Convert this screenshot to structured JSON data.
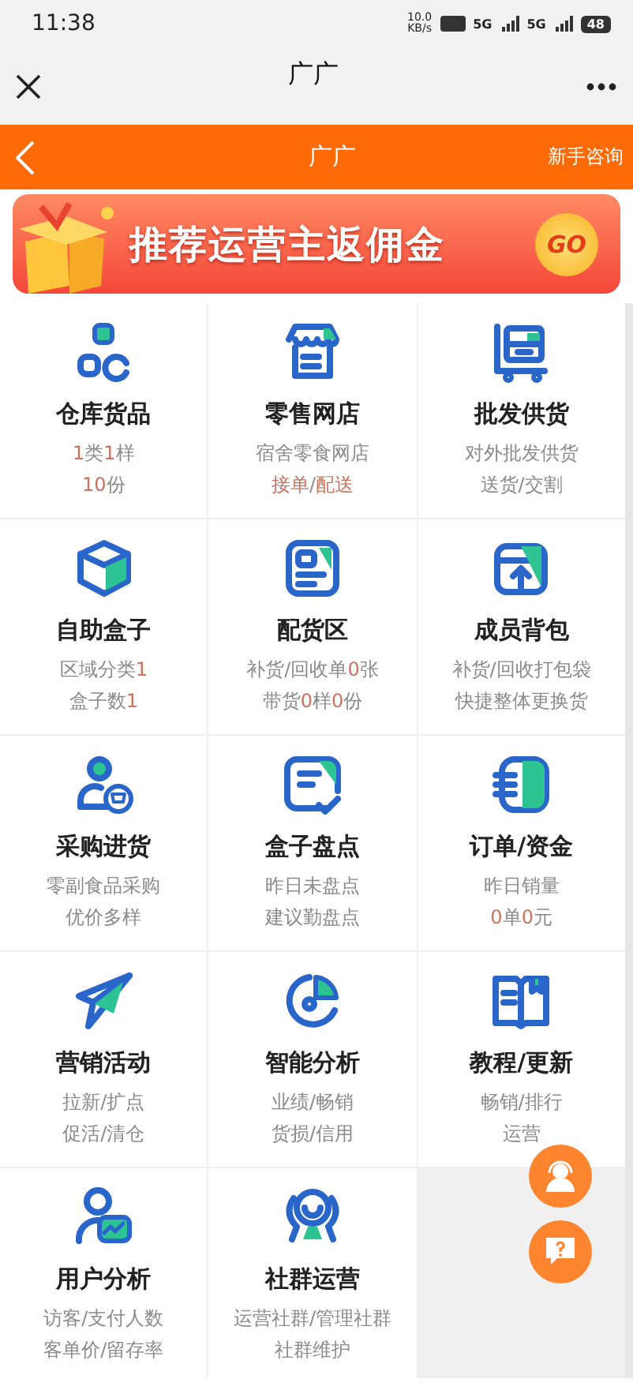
{
  "status_bar": {
    "time": "11:38",
    "speed": "10.0",
    "speed_unit": "KB/s",
    "signals": [
      "5G",
      "5G"
    ],
    "battery": "48"
  },
  "webview": {
    "title": "广广"
  },
  "nav": {
    "title": "广广",
    "action": "新手咨询"
  },
  "banner": {
    "text": "推荐运营主返佣金",
    "button": "GO"
  },
  "tiles": [
    {
      "title": "仓库货品",
      "lines": [
        [
          {
            "text": "1",
            "accent": true
          },
          {
            "text": "类",
            "accent": false
          },
          {
            "text": "1",
            "accent": true
          },
          {
            "text": "样",
            "accent": false
          }
        ],
        [
          {
            "text": "10",
            "accent": true
          },
          {
            "text": "份",
            "accent": false
          }
        ]
      ]
    },
    {
      "title": "零售网店",
      "lines": [
        [
          {
            "text": "宿舍零食网店",
            "accent": false
          }
        ],
        [
          {
            "text": "接单",
            "accent": true
          },
          {
            "text": "/",
            "accent": false
          },
          {
            "text": "配送",
            "accent": true
          }
        ]
      ]
    },
    {
      "title": "批发供货",
      "lines": [
        [
          {
            "text": "对外批发供货",
            "accent": false
          }
        ],
        [
          {
            "text": "送货/交割",
            "accent": false
          }
        ]
      ]
    },
    {
      "title": "自助盒子",
      "lines": [
        [
          {
            "text": "区域分类",
            "accent": false
          },
          {
            "text": "1",
            "accent": true
          }
        ],
        [
          {
            "text": "盒子数",
            "accent": false
          },
          {
            "text": "1",
            "accent": true
          }
        ]
      ]
    },
    {
      "title": "配货区",
      "lines": [
        [
          {
            "text": "补货/回收单",
            "accent": false
          },
          {
            "text": "0",
            "accent": true
          },
          {
            "text": "张",
            "accent": false
          }
        ],
        [
          {
            "text": "带货",
            "accent": false
          },
          {
            "text": "0",
            "accent": true
          },
          {
            "text": "样",
            "accent": false
          },
          {
            "text": "0",
            "accent": true
          },
          {
            "text": "份",
            "accent": false
          }
        ]
      ]
    },
    {
      "title": "成员背包",
      "lines": [
        [
          {
            "text": "补货/回收打包袋",
            "accent": false
          }
        ],
        [
          {
            "text": "快捷整体更换货",
            "accent": false
          }
        ]
      ]
    },
    {
      "title": "采购进货",
      "lines": [
        [
          {
            "text": "零副食品采购",
            "accent": false
          }
        ],
        [
          {
            "text": "优价多样",
            "accent": false
          }
        ]
      ]
    },
    {
      "title": "盒子盘点",
      "lines": [
        [
          {
            "text": "昨日未盘点",
            "accent": false
          }
        ],
        [
          {
            "text": "建议勤盘点",
            "accent": false
          }
        ]
      ]
    },
    {
      "title": "订单/资金",
      "lines": [
        [
          {
            "text": "昨日销量",
            "accent": false
          }
        ],
        [
          {
            "text": "0",
            "accent": true
          },
          {
            "text": "单",
            "accent": false
          },
          {
            "text": "0",
            "accent": true
          },
          {
            "text": "元",
            "accent": false
          }
        ]
      ]
    },
    {
      "title": "营销活动",
      "lines": [
        [
          {
            "text": "拉新/扩点",
            "accent": false
          }
        ],
        [
          {
            "text": "促活/清仓",
            "accent": false
          }
        ]
      ]
    },
    {
      "title": "智能分析",
      "lines": [
        [
          {
            "text": "业绩/畅销",
            "accent": false
          }
        ],
        [
          {
            "text": "货损/信用",
            "accent": false
          }
        ]
      ]
    },
    {
      "title": "教程/更新",
      "lines": [
        [
          {
            "text": "畅销/排行",
            "accent": false
          }
        ],
        [
          {
            "text": "运营",
            "accent": false
          }
        ]
      ]
    },
    {
      "title": "用户分析",
      "lines": [
        [
          {
            "text": "访客/支付人数",
            "accent": false
          }
        ],
        [
          {
            "text": "客单价/留存率",
            "accent": false
          }
        ]
      ]
    },
    {
      "title": "社群运营",
      "lines": [
        [
          {
            "text": "运营社群/管理社群",
            "accent": false
          }
        ],
        [
          {
            "text": "社群维护",
            "accent": false
          }
        ]
      ]
    }
  ],
  "floating_buttons": [
    {
      "kind": "support"
    },
    {
      "kind": "help"
    }
  ]
}
